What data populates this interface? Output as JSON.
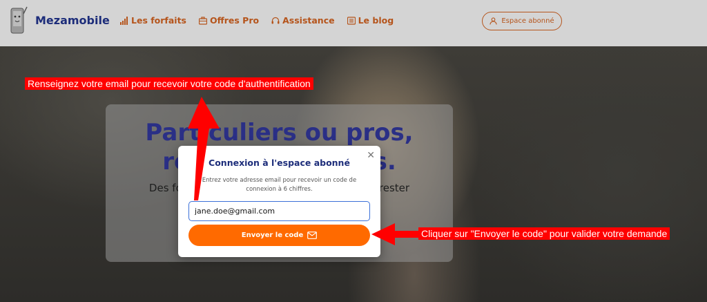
{
  "header": {
    "brand": "Mezamobile",
    "nav": [
      {
        "label": "Les forfaits",
        "icon": "signal-bars-icon"
      },
      {
        "label": "Offres Pro",
        "icon": "briefcase-icon"
      },
      {
        "label": "Assistance",
        "icon": "headset-icon"
      },
      {
        "label": "Le blog",
        "icon": "newspaper-icon"
      }
    ],
    "account_button": "Espace abonné",
    "account_icon": "user-icon"
  },
  "hero": {
    "title_line1": "Particuliers ou pros,",
    "title_line2": "restez connectés.",
    "subtitle": "Des forfaits mobiles sans engagement pour rester"
  },
  "modal": {
    "title": "Connexion à l'espace abonné",
    "description": "Entrez votre adresse email pour recevoir un code de connexion à 6 chiffres.",
    "email_value": "jane.doe@gmail.com",
    "send_button": "Envoyer le code",
    "send_icon": "envelope-icon",
    "close_icon": "close-icon"
  },
  "annotations": {
    "email_hint": "Renseignez votre email pour recevoir votre code d'authentification",
    "send_hint": "Cliquer sur \"Envoyer le code\" pour valider votre demande"
  },
  "colors": {
    "brand_blue": "#1d2d7a",
    "accent_orange": "#ff6a00",
    "annotation_red": "#ff0000"
  }
}
